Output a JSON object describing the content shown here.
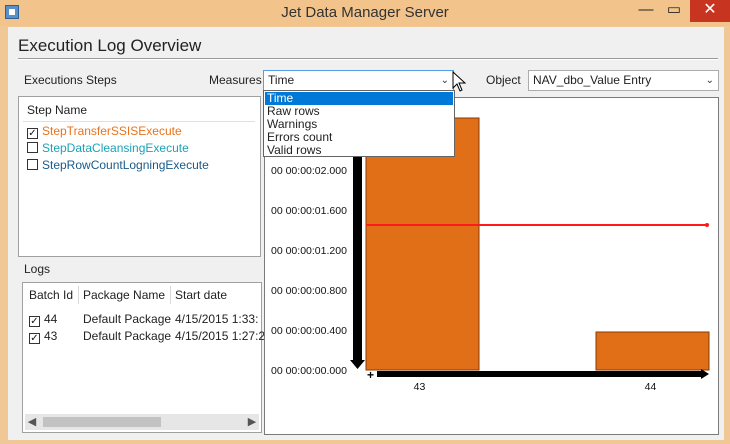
{
  "window": {
    "title": "Jet Data Manager Server"
  },
  "page": {
    "title": "Execution Log Overview"
  },
  "labels": {
    "steps": "Executions Steps",
    "measures": "Measures",
    "object": "Object",
    "logs": "Logs"
  },
  "measures": {
    "value": "Time",
    "options": [
      "Time",
      "Raw rows",
      "Warnings",
      "Errors count",
      "Valid rows"
    ],
    "selected_index": 0
  },
  "object": {
    "value": "NAV_dbo_Value Entry"
  },
  "steps": {
    "header": "Step Name",
    "items": [
      {
        "label": "StepTransferSSISExecute",
        "checked": true,
        "color": "#e8731c"
      },
      {
        "label": "StepDataCleansingExecute",
        "checked": false,
        "color": "#1aa3b8"
      },
      {
        "label": "StepRowCountLogningExecute",
        "checked": false,
        "color": "#1a5a8a"
      }
    ]
  },
  "logs": {
    "columns": [
      "Batch Id",
      "Package Name",
      "Start date"
    ],
    "rows": [
      {
        "checked": true,
        "batch_id": "44",
        "package": "Default Package",
        "start": "4/15/2015 1:33:"
      },
      {
        "checked": true,
        "batch_id": "43",
        "package": "Default Package",
        "start": "4/15/2015 1:27:2"
      }
    ]
  },
  "chart_data": {
    "type": "bar",
    "categories": [
      "43",
      "44"
    ],
    "series": [
      {
        "values": [
          2.55,
          0.38
        ],
        "color": "#e06f18"
      }
    ],
    "reference_line": {
      "value": 1.45,
      "color": "#ff1a1a"
    },
    "y_ticks": [
      "00 00:00:00.000",
      "00 00:00:00.400",
      "00 00:00:00.800",
      "00 00:00:01.200",
      "00 00:00:01.600",
      "00 00:00:02.000"
    ],
    "ylim": [
      0,
      2.55
    ],
    "grid": false
  },
  "colors": {
    "accent": "#0078d7",
    "close": "#c7341f",
    "bar": "#e06f18",
    "bar_edge": "#8a3a05"
  }
}
